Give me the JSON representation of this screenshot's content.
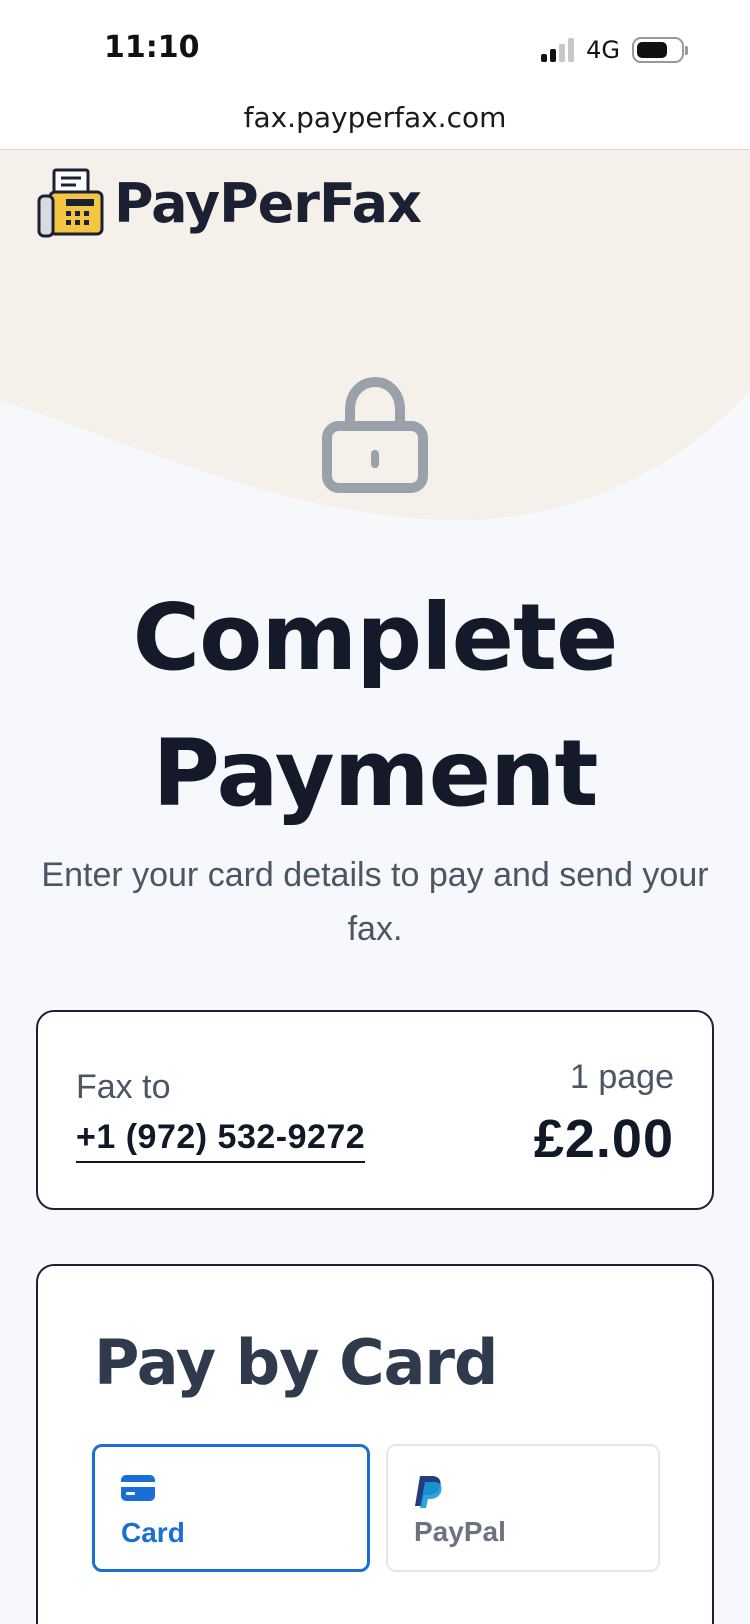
{
  "status_bar": {
    "time": "11:10",
    "network": "4G"
  },
  "browser": {
    "url": "fax.payperfax.com"
  },
  "brand": {
    "name": "PayPerFax",
    "accent": "#f4c542"
  },
  "hero": {
    "title_line1": "Complete",
    "title_line2": "Payment",
    "subtitle": "Enter your card details to pay and send your fax."
  },
  "summary": {
    "fax_to_label": "Fax to",
    "fax_number": "+1 (972) 532-9272",
    "pages": "1 page",
    "price": "£2.00"
  },
  "payment": {
    "title": "Pay by Card",
    "methods": [
      {
        "label": "Card",
        "icon": "credit-card-icon",
        "selected": true
      },
      {
        "label": "PayPal",
        "icon": "paypal-icon",
        "selected": false
      }
    ],
    "selected_color": "#1a6fd6"
  },
  "colors": {
    "hero_bg": "#f5f0ea",
    "page_bg": "#f6f8fb",
    "heading": "#141a2a"
  }
}
